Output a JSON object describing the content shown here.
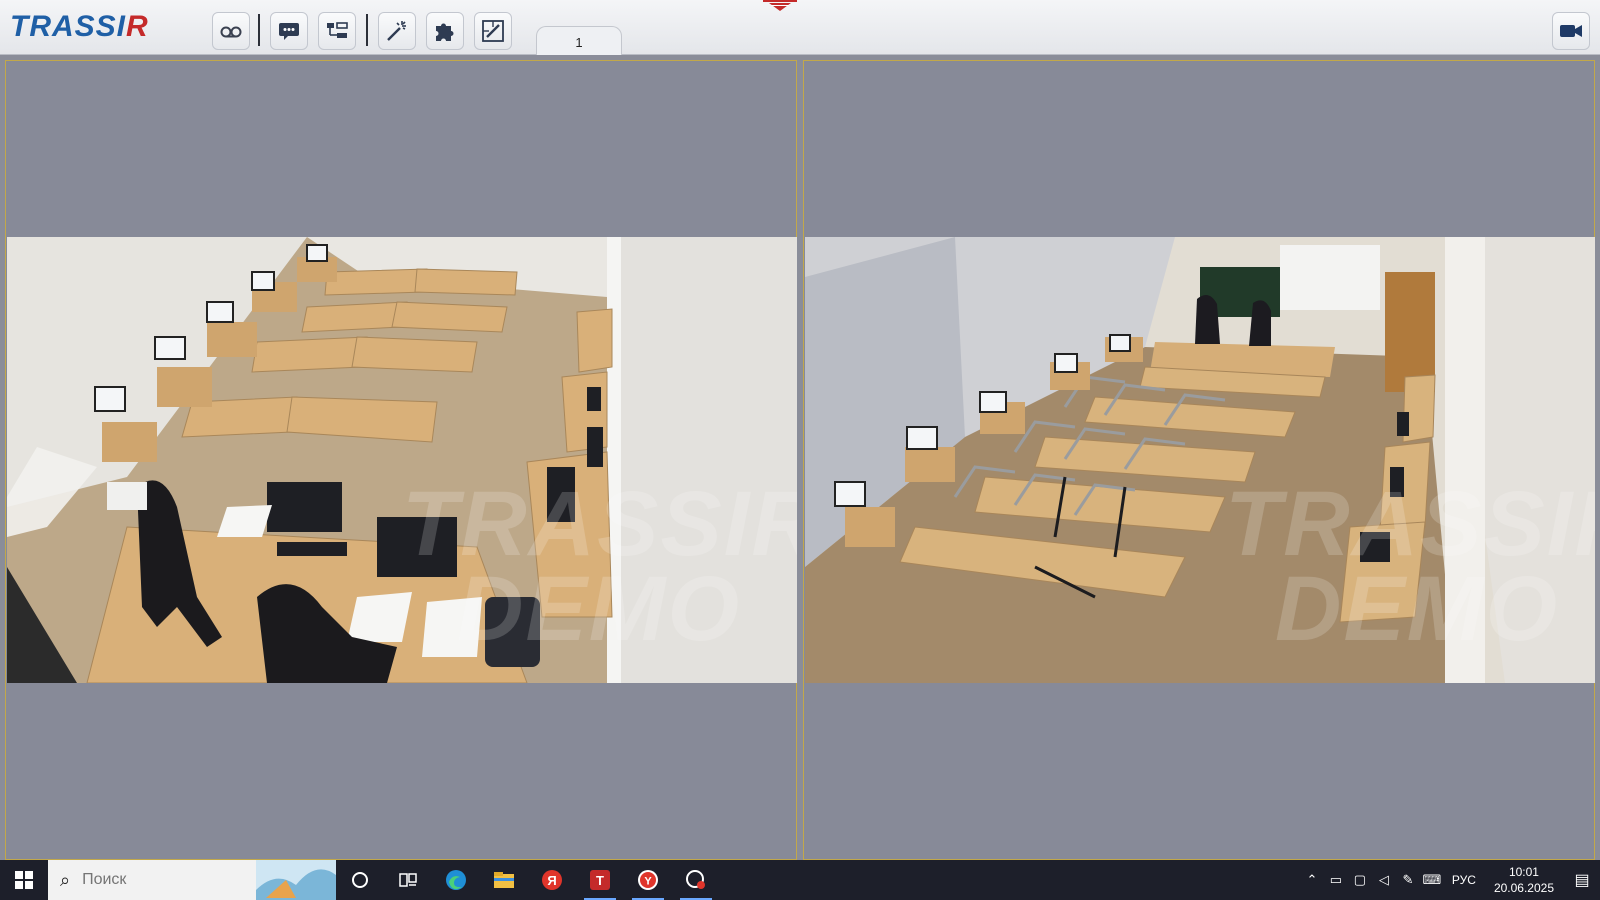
{
  "app": {
    "logo_left": "TRASSI",
    "logo_r": "R"
  },
  "toolbar": {
    "buttons": [
      {
        "name": "archive-button",
        "icon": "voicemail-icon"
      },
      {
        "name": "messages-button",
        "icon": "chat-icon"
      },
      {
        "name": "layout-button",
        "icon": "tree-icon"
      },
      {
        "name": "settings-wizard-button",
        "icon": "wand-icon"
      },
      {
        "name": "plugins-button",
        "icon": "puzzle-icon"
      },
      {
        "name": "editor-button",
        "icon": "edit-icon"
      }
    ],
    "tab_label": "1",
    "camera_button_icon": "video-camera-icon"
  },
  "watermark": {
    "line1": "TRASSIR",
    "line2": "DEMO"
  },
  "taskbar": {
    "search_placeholder": "Поиск",
    "apps": [
      "cortana-icon",
      "task-view-icon",
      "edge-icon",
      "explorer-icon",
      "yandex-icon",
      "trassir-icon",
      "yandex-browser-icon",
      "screen-recorder-icon"
    ],
    "language": "РУС",
    "time": "10:01",
    "date": "20.06.2025"
  }
}
